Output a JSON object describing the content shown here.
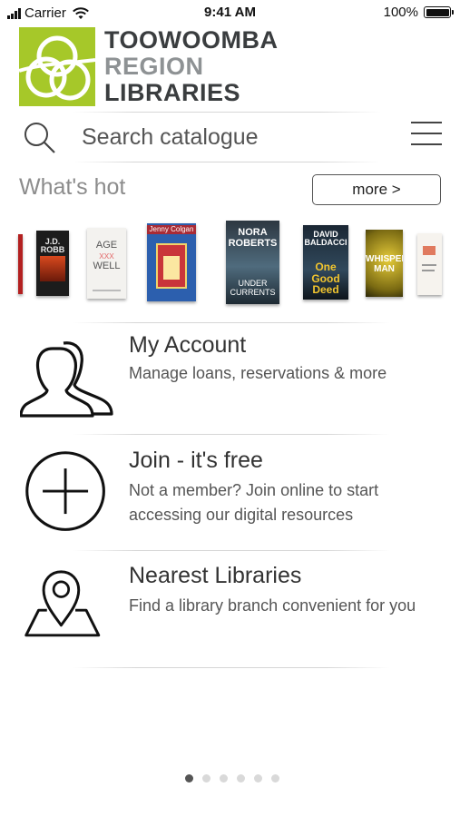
{
  "status": {
    "carrier": "Carrier",
    "time": "9:41 AM",
    "battery": "100%"
  },
  "logo": {
    "line1": "TOOWOOMBA",
    "line2": "REGION",
    "line3": "LIBRARIES",
    "mark_color": "#a6c829"
  },
  "search": {
    "placeholder": "Search catalogue"
  },
  "hot": {
    "title": "What's hot",
    "more_label": "more >",
    "books": [
      {
        "name": "book-cover-1",
        "text": ""
      },
      {
        "name": "book-cover-2",
        "text": "J.D. ROBB"
      },
      {
        "name": "book-cover-3",
        "text": "AGE WELL PROJECT"
      },
      {
        "name": "book-cover-4",
        "text": "Jenny Colgan"
      },
      {
        "name": "book-cover-5",
        "text": "NORA ROBERTS UNDER CURRENTS"
      },
      {
        "name": "book-cover-6",
        "text": "DAVID BALDACCI One Good Deed"
      },
      {
        "name": "book-cover-7",
        "text": "WHISPER MAN"
      },
      {
        "name": "book-cover-8",
        "text": ""
      }
    ]
  },
  "menu": [
    {
      "title": "My Account",
      "subtitle": "Manage loans, reservations & more",
      "icon": "users-icon"
    },
    {
      "title": "Join - it's free",
      "subtitle": "Not a member? Join online to start accessing our digital resources",
      "icon": "plus-circle-icon"
    },
    {
      "title": "Nearest Libraries",
      "subtitle": "Find a library branch convenient for you",
      "icon": "map-pin-icon"
    }
  ],
  "pager": {
    "pages": 6,
    "active": 1
  }
}
